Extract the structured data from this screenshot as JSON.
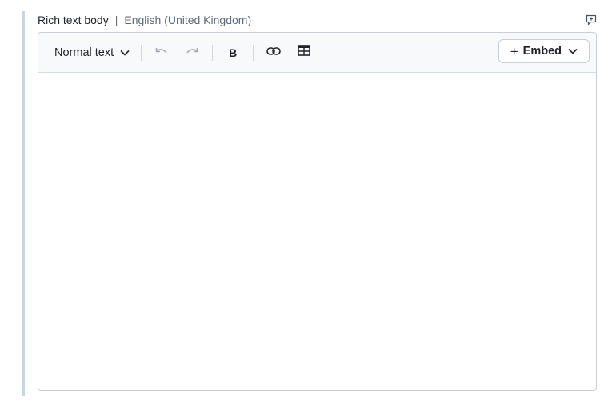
{
  "field": {
    "name": "Rich text body",
    "separator": "|",
    "locale": "English (United Kingdom)"
  },
  "toolbar": {
    "format_select": "Normal text",
    "bold_label": "B",
    "embed_label": "Embed",
    "embed_plus": "+"
  },
  "icons": {
    "comment": "comment-icon",
    "undo": "undo-icon",
    "redo": "redo-icon",
    "link": "link-icon",
    "table": "table-icon",
    "chevron": "chevron-down-icon"
  },
  "colors": {
    "toolbar_bg": "#f7f9fa",
    "border": "#c8ced6",
    "rule": "#c9d5e0",
    "text": "#1f2329",
    "muted": "#5f6b7a"
  },
  "editor": {
    "content": ""
  }
}
